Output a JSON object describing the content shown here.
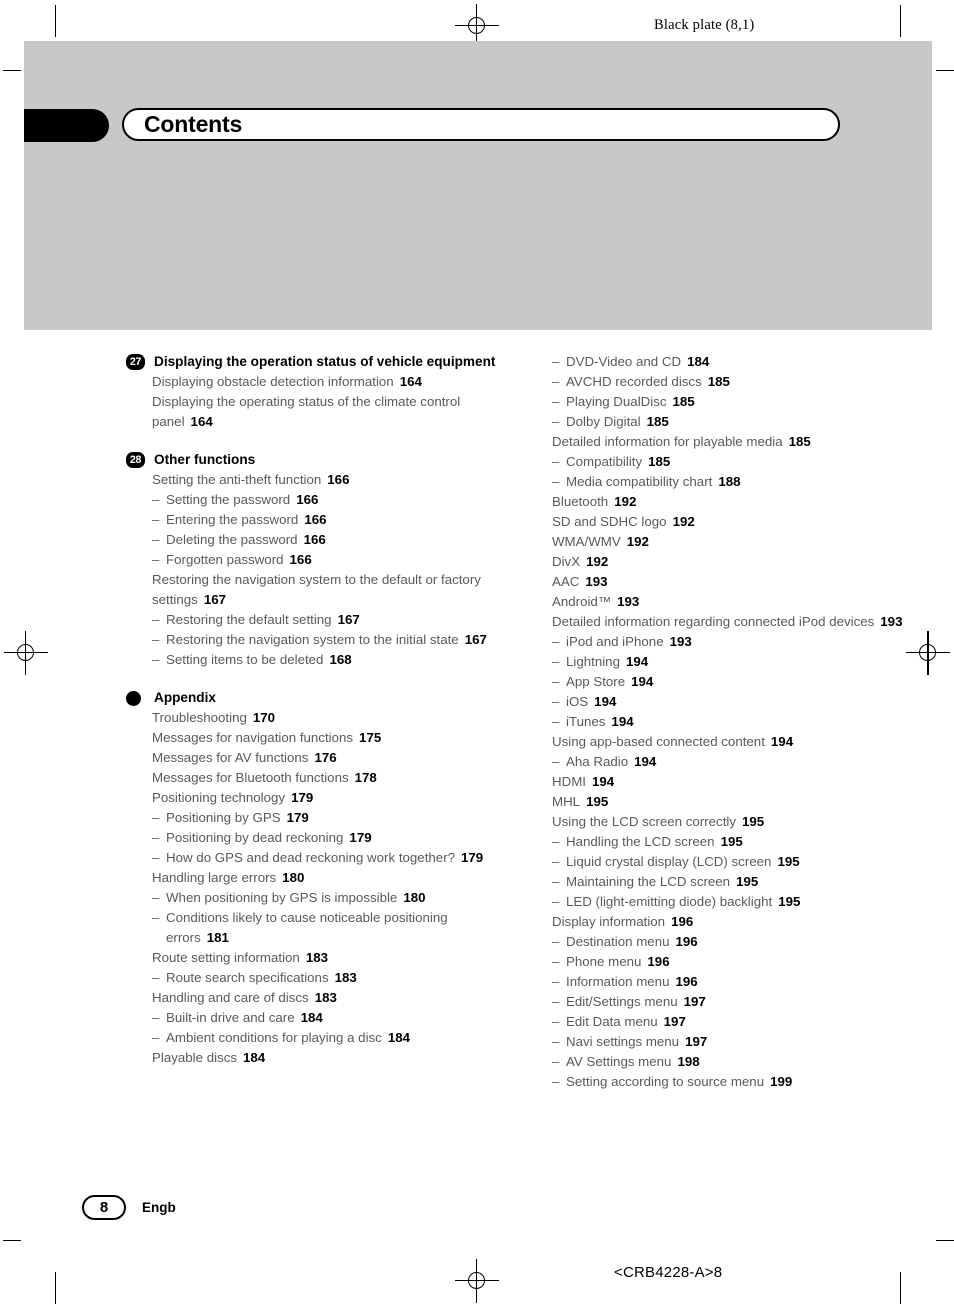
{
  "header": {
    "plate_caption": "Black plate (8,1)",
    "title": "Contents"
  },
  "footer": {
    "page_number": "8",
    "language_code": "Engb",
    "document_code": "<CRB4228-A>8"
  },
  "left_column": [
    {
      "badge": "27",
      "badge_type": "number",
      "heading": "Displaying the operation status of vehicle equipment",
      "entries": [
        {
          "level": "top",
          "text": "Displaying obstacle detection information",
          "page": "164"
        },
        {
          "level": "top",
          "text": "Displaying the operating status of the climate control panel",
          "page": "164"
        }
      ]
    },
    {
      "badge": "28",
      "badge_type": "number",
      "heading": "Other functions",
      "entries": [
        {
          "level": "top",
          "text": "Setting the anti-theft function",
          "page": "166"
        },
        {
          "level": "sub",
          "text": "Setting the password",
          "page": "166"
        },
        {
          "level": "sub",
          "text": "Entering the password",
          "page": "166"
        },
        {
          "level": "sub",
          "text": "Deleting the password",
          "page": "166"
        },
        {
          "level": "sub",
          "text": "Forgotten password",
          "page": "166"
        },
        {
          "level": "top",
          "text": "Restoring the navigation system to the default or factory settings",
          "page": "167"
        },
        {
          "level": "sub",
          "text": "Restoring the default setting",
          "page": "167"
        },
        {
          "level": "sub",
          "text": "Restoring the navigation system to the initial state",
          "page": "167"
        },
        {
          "level": "sub",
          "text": "Setting items to be deleted",
          "page": "168"
        }
      ]
    },
    {
      "badge": "",
      "badge_type": "dot",
      "heading": "Appendix",
      "entries": [
        {
          "level": "top",
          "text": "Troubleshooting",
          "page": "170"
        },
        {
          "level": "top",
          "text": "Messages for navigation functions",
          "page": "175"
        },
        {
          "level": "top",
          "text": "Messages for AV functions",
          "page": "176"
        },
        {
          "level": "top",
          "text": "Messages for Bluetooth functions",
          "page": "178"
        },
        {
          "level": "top",
          "text": "Positioning technology",
          "page": "179"
        },
        {
          "level": "sub",
          "text": "Positioning by GPS",
          "page": "179"
        },
        {
          "level": "sub",
          "text": "Positioning by dead reckoning",
          "page": "179"
        },
        {
          "level": "sub",
          "text": "How do GPS and dead reckoning work together?",
          "page": "179"
        },
        {
          "level": "top",
          "text": "Handling large errors",
          "page": "180"
        },
        {
          "level": "sub",
          "text": "When positioning by GPS is impossible",
          "page": "180"
        },
        {
          "level": "sub",
          "text": "Conditions likely to cause noticeable positioning errors",
          "page": "181"
        },
        {
          "level": "top",
          "text": "Route setting information",
          "page": "183"
        },
        {
          "level": "sub",
          "text": "Route search specifications",
          "page": "183"
        },
        {
          "level": "top",
          "text": "Handling and care of discs",
          "page": "183"
        },
        {
          "level": "sub",
          "text": "Built-in drive and care",
          "page": "184"
        },
        {
          "level": "sub",
          "text": "Ambient conditions for playing a disc",
          "page": "184"
        },
        {
          "level": "top",
          "text": "Playable discs",
          "page": "184"
        }
      ]
    }
  ],
  "right_column": [
    {
      "level": "sub",
      "text": "DVD-Video and CD",
      "page": "184"
    },
    {
      "level": "sub",
      "text": "AVCHD recorded discs",
      "page": "185"
    },
    {
      "level": "sub",
      "text": "Playing DualDisc",
      "page": "185"
    },
    {
      "level": "sub",
      "text": "Dolby Digital",
      "page": "185"
    },
    {
      "level": "top",
      "text": "Detailed information for playable media",
      "page": "185"
    },
    {
      "level": "sub",
      "text": "Compatibility",
      "page": "185"
    },
    {
      "level": "sub",
      "text": "Media compatibility chart",
      "page": "188"
    },
    {
      "level": "top",
      "text": "Bluetooth",
      "page": "192"
    },
    {
      "level": "top",
      "text": "SD and SDHC logo",
      "page": "192"
    },
    {
      "level": "top",
      "text": "WMA/WMV",
      "page": "192"
    },
    {
      "level": "top",
      "text": "DivX",
      "page": "192"
    },
    {
      "level": "top",
      "text": "AAC",
      "page": "193"
    },
    {
      "level": "top",
      "text": "Android™",
      "page": "193"
    },
    {
      "level": "top",
      "text": "Detailed information regarding connected iPod devices",
      "page": "193"
    },
    {
      "level": "sub",
      "text": "iPod and iPhone",
      "page": "193"
    },
    {
      "level": "sub",
      "text": "Lightning",
      "page": "194"
    },
    {
      "level": "sub",
      "text": "App Store",
      "page": "194"
    },
    {
      "level": "sub",
      "text": "iOS",
      "page": "194"
    },
    {
      "level": "sub",
      "text": "iTunes",
      "page": "194"
    },
    {
      "level": "top",
      "text": "Using app-based connected content",
      "page": "194"
    },
    {
      "level": "sub",
      "text": "Aha Radio",
      "page": "194"
    },
    {
      "level": "top",
      "text": "HDMI",
      "page": "194"
    },
    {
      "level": "top",
      "text": "MHL",
      "page": "195"
    },
    {
      "level": "top",
      "text": "Using the LCD screen correctly",
      "page": "195"
    },
    {
      "level": "sub",
      "text": "Handling the LCD screen",
      "page": "195"
    },
    {
      "level": "sub",
      "text": "Liquid crystal display (LCD) screen",
      "page": "195"
    },
    {
      "level": "sub",
      "text": "Maintaining the LCD screen",
      "page": "195"
    },
    {
      "level": "sub",
      "text": "LED (light-emitting diode) backlight",
      "page": "195"
    },
    {
      "level": "top",
      "text": "Display information",
      "page": "196"
    },
    {
      "level": "sub",
      "text": "Destination menu",
      "page": "196"
    },
    {
      "level": "sub",
      "text": "Phone menu",
      "page": "196"
    },
    {
      "level": "sub",
      "text": "Information menu",
      "page": "196"
    },
    {
      "level": "sub",
      "text": "Edit/Settings menu",
      "page": "197"
    },
    {
      "level": "sub",
      "text": "Edit Data menu",
      "page": "197"
    },
    {
      "level": "sub",
      "text": "Navi settings menu",
      "page": "197"
    },
    {
      "level": "sub",
      "text": "AV Settings menu",
      "page": "198"
    },
    {
      "level": "sub",
      "text": "Setting according to source menu",
      "page": "199"
    }
  ],
  "colors": {
    "band": "#c8c8c8",
    "entry_text": "#5a5a5a",
    "page_number": "#000000"
  }
}
